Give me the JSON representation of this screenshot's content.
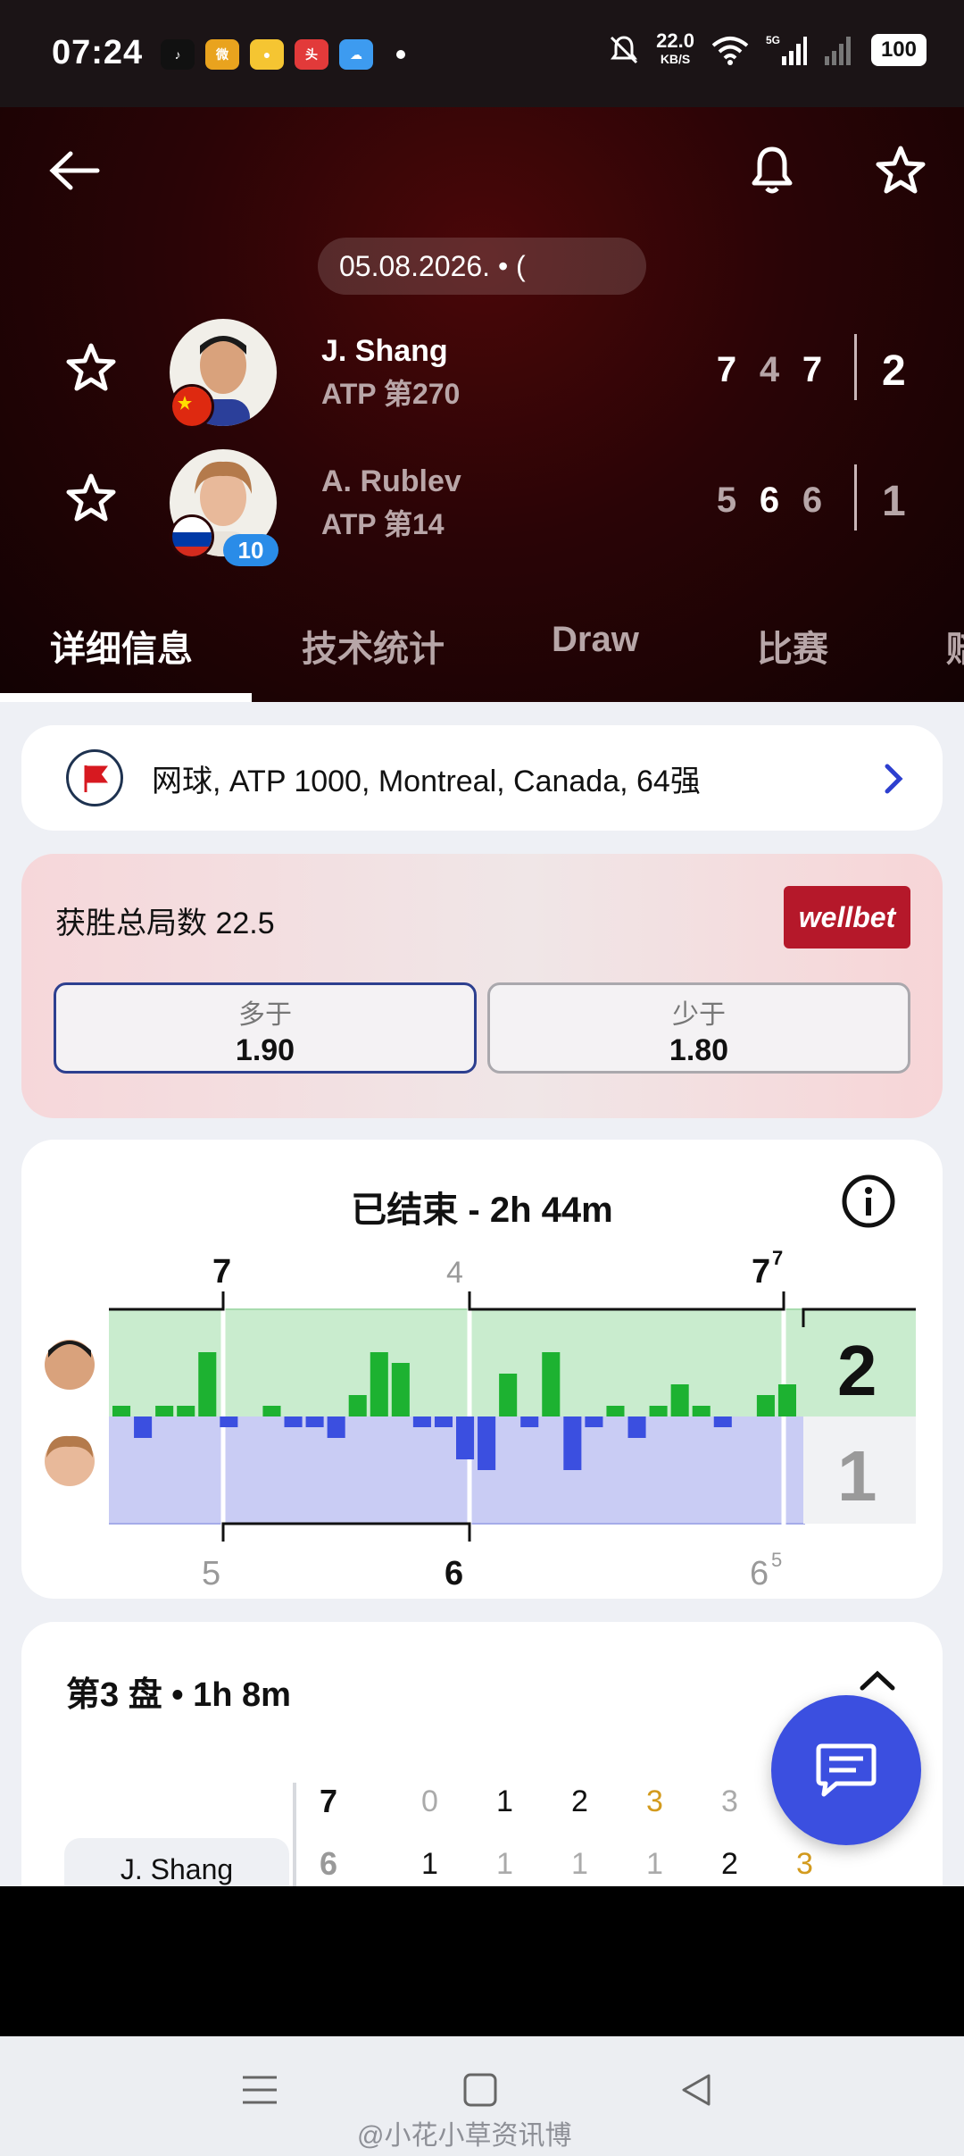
{
  "status_bar": {
    "time": "07:24",
    "net_speed": "22.0",
    "net_unit": "KB/S",
    "signal": "5G",
    "battery": "100"
  },
  "header": {
    "date": "05.08.2026. • (",
    "players": [
      {
        "name": "J. Shang",
        "rank": "ATP 第270",
        "sets": [
          "7",
          "4",
          "7"
        ],
        "total": "2",
        "seed": ""
      },
      {
        "name": "A. Rublev",
        "rank": "ATP 第14",
        "sets": [
          "5",
          "6",
          "6"
        ],
        "total": "1",
        "seed": "10"
      }
    ]
  },
  "tabs": [
    "详细信息",
    "技术统计",
    "Draw",
    "比赛",
    "赔"
  ],
  "tournament": {
    "text": "网球, ATP 1000, Montreal, Canada, 64强"
  },
  "bet": {
    "title": "获胜总局数 22.5",
    "brand": "wellbet",
    "over_label": "多于",
    "over_value": "1.90",
    "under_label": "少于",
    "under_value": "1.80"
  },
  "match_chart": {
    "title": "已结束 - 2h 44m",
    "top_scores": [
      "7",
      "4",
      "7"
    ],
    "top_tiebreak": "7",
    "bottom_scores": [
      "5",
      "6",
      "6"
    ],
    "bottom_tiebreak": "5",
    "total_top": "2",
    "total_bottom": "1",
    "colors": {
      "p1": "#1db231",
      "p2": "#3b4fe0",
      "bg_top": "#c9ecce",
      "bg_bottom": "#c9ccf4"
    }
  },
  "chart_data": {
    "type": "bar",
    "title": "已结束 - 2h 44m",
    "series": [
      {
        "name": "J. Shang",
        "values": [
          1,
          0,
          1,
          1,
          6,
          0,
          0,
          1,
          0,
          0,
          0,
          2,
          6,
          5,
          0,
          0,
          0,
          0,
          4,
          0,
          6,
          0,
          0,
          1,
          0,
          1,
          3,
          1,
          0,
          0,
          2,
          3
        ]
      },
      {
        "name": "A. Rublev",
        "values": [
          0,
          2,
          0,
          0,
          0,
          1,
          0,
          0,
          1,
          1,
          2,
          0,
          0,
          0,
          1,
          1,
          4,
          5,
          0,
          1,
          0,
          5,
          1,
          0,
          2,
          0,
          0,
          0,
          1,
          0,
          0,
          0
        ]
      }
    ],
    "set_boundaries_after_game": [
      4,
      14,
      31
    ]
  },
  "set3": {
    "title": "第3 盘 • 1h 8m",
    "p1_name": "J. Shang",
    "p1_set": "7",
    "p2_set": "6",
    "p1_games": [
      "0",
      "1",
      "2",
      "3",
      "3"
    ],
    "p2_games": [
      "1",
      "1",
      "1",
      "1",
      "2",
      "3"
    ]
  },
  "watermark": "@小花小草资讯博"
}
